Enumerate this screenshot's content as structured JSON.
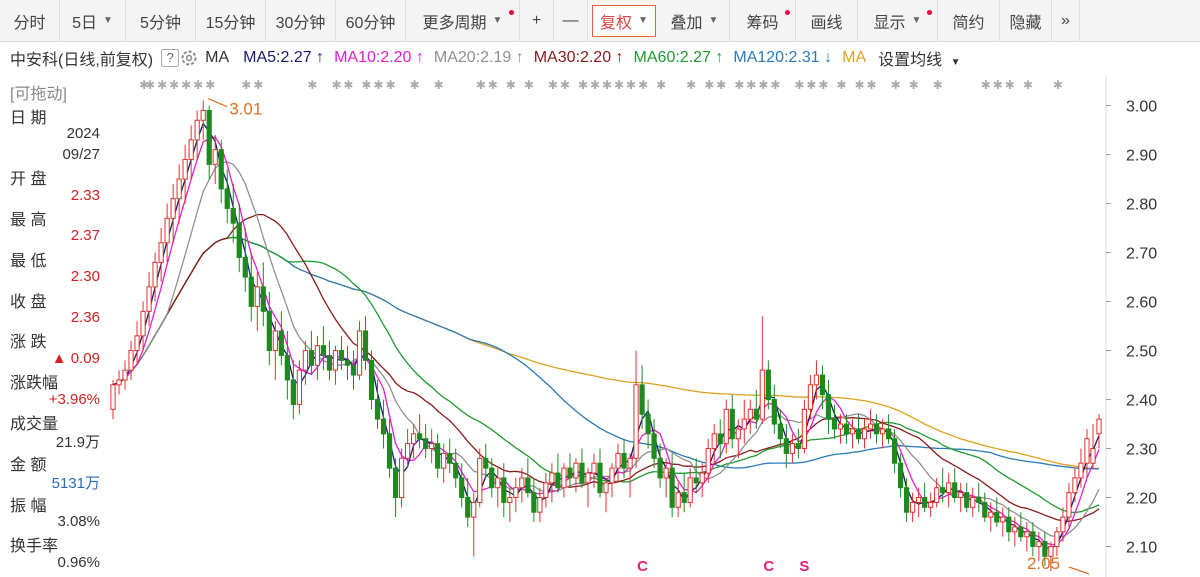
{
  "toolbar": {
    "items": [
      {
        "label": "分时",
        "caret": false,
        "dot": false,
        "active": false,
        "w": 60
      },
      {
        "label": "5日",
        "caret": true,
        "dot": false,
        "active": false,
        "w": 66
      },
      {
        "label": "5分钟",
        "caret": false,
        "dot": false,
        "active": false,
        "w": 70
      },
      {
        "label": "15分钟",
        "caret": false,
        "dot": false,
        "active": false,
        "w": 70
      },
      {
        "label": "30分钟",
        "caret": false,
        "dot": false,
        "active": false,
        "w": 70
      },
      {
        "label": "60分钟",
        "caret": false,
        "dot": false,
        "active": false,
        "w": 70
      },
      {
        "label": "更多周期",
        "caret": true,
        "dot": true,
        "active": false,
        "w": 114
      },
      {
        "label": "+",
        "caret": false,
        "dot": false,
        "active": false,
        "w": 34
      },
      {
        "label": "—",
        "caret": false,
        "dot": false,
        "active": false,
        "w": 34
      },
      {
        "label": "复权",
        "caret": true,
        "dot": false,
        "active": true,
        "w": 72
      },
      {
        "label": "叠加",
        "caret": true,
        "dot": false,
        "active": false,
        "w": 70
      },
      {
        "label": "筹码",
        "caret": false,
        "dot": true,
        "active": false,
        "w": 66
      },
      {
        "label": "画线",
        "caret": false,
        "dot": false,
        "active": false,
        "w": 62
      },
      {
        "label": "显示",
        "caret": true,
        "dot": true,
        "active": false,
        "w": 80
      },
      {
        "label": "简约",
        "caret": false,
        "dot": false,
        "active": false,
        "w": 62
      },
      {
        "label": "隐藏",
        "caret": false,
        "dot": false,
        "active": false,
        "w": 52
      },
      {
        "label": "»",
        "caret": false,
        "dot": false,
        "active": false,
        "w": 28
      }
    ],
    "caret_glyph": "▼"
  },
  "legend": {
    "stock": "中安科",
    "mode": "(日线,前复权)",
    "help": "?",
    "ma_label": "MA",
    "mas": [
      {
        "text": "MA5:2.27",
        "arrow": "↑",
        "color": "#1a1a6e"
      },
      {
        "text": "MA10:2.20",
        "arrow": "↑",
        "color": "#e020d0"
      },
      {
        "text": "MA20:2.19",
        "arrow": "↑",
        "color": "#909090"
      },
      {
        "text": "MA30:2.20",
        "arrow": "↑",
        "color": "#8b1a1a"
      },
      {
        "text": "MA60:2.27",
        "arrow": "↑",
        "color": "#1f9a2f"
      },
      {
        "text": "MA120:2.31",
        "arrow": "↓",
        "color": "#2a7ab8"
      },
      {
        "text": "MA",
        "arrow": "",
        "color": "#e0a020"
      }
    ],
    "settings": "设置均线"
  },
  "sidebar": {
    "title": "[可拖动]",
    "rows": [
      {
        "label": "日  期",
        "value": "",
        "color": "#333"
      },
      {
        "label": "",
        "value": "2024",
        "color": "#333"
      },
      {
        "label": "",
        "value": "09/27",
        "color": "#333"
      },
      {
        "label": "开  盘",
        "value": "",
        "color": "#333"
      },
      {
        "label": "",
        "value": "2.33",
        "color": "#d42020"
      },
      {
        "label": "最  高",
        "value": "",
        "color": "#333"
      },
      {
        "label": "",
        "value": "2.37",
        "color": "#d42020"
      },
      {
        "label": "最  低",
        "value": "",
        "color": "#333"
      },
      {
        "label": "",
        "value": "2.30",
        "color": "#d42020"
      },
      {
        "label": "收  盘",
        "value": "",
        "color": "#333"
      },
      {
        "label": "",
        "value": "2.36",
        "color": "#d42020"
      },
      {
        "label": "涨  跌",
        "value": "",
        "color": "#333"
      },
      {
        "label": "",
        "value": "▲ 0.09",
        "color": "#d42020"
      },
      {
        "label": "涨跌幅",
        "value": "",
        "color": "#333"
      },
      {
        "label": "",
        "value": "+3.96%",
        "color": "#d42020"
      },
      {
        "label": "成交量",
        "value": "",
        "color": "#333"
      },
      {
        "label": "",
        "value": "21.9万",
        "color": "#333"
      },
      {
        "label": "金  额",
        "value": "",
        "color": "#333"
      },
      {
        "label": "",
        "value": "5131万",
        "color": "#2a6ab8"
      },
      {
        "label": "振  幅",
        "value": "",
        "color": "#333"
      },
      {
        "label": "",
        "value": "3.08%",
        "color": "#333"
      },
      {
        "label": "换手率",
        "value": "",
        "color": "#333"
      },
      {
        "label": "",
        "value": "0.96%",
        "color": "#333"
      }
    ]
  },
  "chart_data": {
    "type": "candlestick",
    "ylim": [
      2.05,
      3.04
    ],
    "yticks": [
      3.0,
      2.9,
      2.8,
      2.7,
      2.6,
      2.5,
      2.4,
      2.3,
      2.2,
      2.1
    ],
    "up_color": "#e03030",
    "down_color": "#1e8a1e",
    "grid": false,
    "annotations": [
      {
        "text": "3.01",
        "index": 15,
        "price": 3.01
      },
      {
        "text": "2.05",
        "index": 163,
        "price": 2.05
      }
    ],
    "markers": [
      {
        "text": "C",
        "index": 88
      },
      {
        "text": "C",
        "index": 109
      },
      {
        "text": "S",
        "index": 115
      }
    ],
    "ohlc": [
      [
        2.38,
        2.44,
        2.36,
        2.43
      ],
      [
        2.43,
        2.46,
        2.41,
        2.44
      ],
      [
        2.44,
        2.48,
        2.42,
        2.46
      ],
      [
        2.46,
        2.52,
        2.44,
        2.5
      ],
      [
        2.5,
        2.56,
        2.47,
        2.53
      ],
      [
        2.53,
        2.6,
        2.5,
        2.58
      ],
      [
        2.58,
        2.66,
        2.55,
        2.63
      ],
      [
        2.63,
        2.7,
        2.6,
        2.68
      ],
      [
        2.68,
        2.75,
        2.64,
        2.72
      ],
      [
        2.72,
        2.8,
        2.68,
        2.77
      ],
      [
        2.77,
        2.84,
        2.72,
        2.81
      ],
      [
        2.81,
        2.88,
        2.76,
        2.85
      ],
      [
        2.85,
        2.92,
        2.8,
        2.89
      ],
      [
        2.89,
        2.96,
        2.85,
        2.93
      ],
      [
        2.93,
        2.99,
        2.89,
        2.97
      ],
      [
        2.97,
        3.01,
        2.93,
        2.99
      ],
      [
        2.99,
        3.0,
        2.85,
        2.88
      ],
      [
        2.88,
        2.94,
        2.84,
        2.91
      ],
      [
        2.91,
        2.93,
        2.8,
        2.83
      ],
      [
        2.83,
        2.87,
        2.76,
        2.79
      ],
      [
        2.79,
        2.84,
        2.72,
        2.76
      ],
      [
        2.76,
        2.8,
        2.66,
        2.69
      ],
      [
        2.69,
        2.75,
        2.62,
        2.65
      ],
      [
        2.65,
        2.7,
        2.56,
        2.59
      ],
      [
        2.59,
        2.66,
        2.54,
        2.63
      ],
      [
        2.63,
        2.68,
        2.55,
        2.58
      ],
      [
        2.58,
        2.62,
        2.47,
        2.5
      ],
      [
        2.5,
        2.56,
        2.44,
        2.54
      ],
      [
        2.54,
        2.58,
        2.47,
        2.49
      ],
      [
        2.49,
        2.54,
        2.4,
        2.44
      ],
      [
        2.44,
        2.48,
        2.36,
        2.39
      ],
      [
        2.39,
        2.48,
        2.37,
        2.46
      ],
      [
        2.46,
        2.52,
        2.43,
        2.5
      ],
      [
        2.5,
        2.54,
        2.45,
        2.47
      ],
      [
        2.47,
        2.53,
        2.44,
        2.51
      ],
      [
        2.51,
        2.55,
        2.46,
        2.49
      ],
      [
        2.49,
        2.52,
        2.44,
        2.46
      ],
      [
        2.46,
        2.51,
        2.43,
        2.5
      ],
      [
        2.5,
        2.53,
        2.46,
        2.48
      ],
      [
        2.48,
        2.51,
        2.44,
        2.47
      ],
      [
        2.47,
        2.5,
        2.42,
        2.45
      ],
      [
        2.45,
        2.56,
        2.44,
        2.54
      ],
      [
        2.54,
        2.57,
        2.46,
        2.48
      ],
      [
        2.48,
        2.5,
        2.38,
        2.4
      ],
      [
        2.4,
        2.44,
        2.34,
        2.36
      ],
      [
        2.36,
        2.4,
        2.3,
        2.33
      ],
      [
        2.33,
        2.36,
        2.24,
        2.26
      ],
      [
        2.26,
        2.28,
        2.16,
        2.2
      ],
      [
        2.2,
        2.3,
        2.18,
        2.28
      ],
      [
        2.28,
        2.34,
        2.26,
        2.31
      ],
      [
        2.31,
        2.35,
        2.28,
        2.33
      ],
      [
        2.33,
        2.37,
        2.3,
        2.32
      ],
      [
        2.32,
        2.35,
        2.28,
        2.3
      ],
      [
        2.3,
        2.34,
        2.27,
        2.31
      ],
      [
        2.31,
        2.33,
        2.24,
        2.26
      ],
      [
        2.26,
        2.31,
        2.23,
        2.29
      ],
      [
        2.29,
        2.32,
        2.25,
        2.27
      ],
      [
        2.27,
        2.3,
        2.22,
        2.24
      ],
      [
        2.24,
        2.27,
        2.18,
        2.2
      ],
      [
        2.2,
        2.24,
        2.14,
        2.16
      ],
      [
        2.16,
        2.21,
        2.08,
        2.19
      ],
      [
        2.19,
        2.3,
        2.18,
        2.28
      ],
      [
        2.28,
        2.31,
        2.24,
        2.26
      ],
      [
        2.26,
        2.28,
        2.2,
        2.22
      ],
      [
        2.22,
        2.26,
        2.18,
        2.24
      ],
      [
        2.24,
        2.27,
        2.16,
        2.19
      ],
      [
        2.19,
        2.22,
        2.15,
        2.2
      ],
      [
        2.2,
        2.24,
        2.17,
        2.22
      ],
      [
        2.22,
        2.26,
        2.19,
        2.24
      ],
      [
        2.24,
        2.28,
        2.2,
        2.21
      ],
      [
        2.21,
        2.24,
        2.15,
        2.17
      ],
      [
        2.17,
        2.22,
        2.15,
        2.2
      ],
      [
        2.2,
        2.25,
        2.18,
        2.23
      ],
      [
        2.23,
        2.27,
        2.19,
        2.25
      ],
      [
        2.25,
        2.29,
        2.21,
        2.22
      ],
      [
        2.22,
        2.27,
        2.2,
        2.26
      ],
      [
        2.26,
        2.29,
        2.22,
        2.24
      ],
      [
        2.24,
        2.28,
        2.21,
        2.27
      ],
      [
        2.27,
        2.3,
        2.22,
        2.23
      ],
      [
        2.23,
        2.26,
        2.18,
        2.25
      ],
      [
        2.25,
        2.29,
        2.22,
        2.27
      ],
      [
        2.27,
        2.3,
        2.2,
        2.21
      ],
      [
        2.21,
        2.24,
        2.17,
        2.23
      ],
      [
        2.23,
        2.27,
        2.2,
        2.26
      ],
      [
        2.26,
        2.31,
        2.23,
        2.29
      ],
      [
        2.29,
        2.32,
        2.24,
        2.26
      ],
      [
        2.26,
        2.29,
        2.2,
        2.28
      ],
      [
        2.28,
        2.5,
        2.26,
        2.43
      ],
      [
        2.43,
        2.47,
        2.34,
        2.37
      ],
      [
        2.37,
        2.4,
        2.3,
        2.33
      ],
      [
        2.33,
        2.36,
        2.26,
        2.28
      ],
      [
        2.28,
        2.31,
        2.22,
        2.24
      ],
      [
        2.24,
        2.28,
        2.2,
        2.26
      ],
      [
        2.26,
        2.29,
        2.16,
        2.18
      ],
      [
        2.18,
        2.23,
        2.16,
        2.21
      ],
      [
        2.21,
        2.25,
        2.17,
        2.19
      ],
      [
        2.19,
        2.26,
        2.18,
        2.24
      ],
      [
        2.24,
        2.28,
        2.21,
        2.23
      ],
      [
        2.23,
        2.27,
        2.2,
        2.25
      ],
      [
        2.25,
        2.32,
        2.23,
        2.3
      ],
      [
        2.3,
        2.35,
        2.27,
        2.33
      ],
      [
        2.33,
        2.36,
        2.28,
        2.31
      ],
      [
        2.31,
        2.4,
        2.29,
        2.38
      ],
      [
        2.38,
        2.41,
        2.3,
        2.32
      ],
      [
        2.32,
        2.36,
        2.28,
        2.34
      ],
      [
        2.34,
        2.4,
        2.31,
        2.36
      ],
      [
        2.36,
        2.4,
        2.33,
        2.38
      ],
      [
        2.38,
        2.42,
        2.34,
        2.36
      ],
      [
        2.36,
        2.57,
        2.35,
        2.46
      ],
      [
        2.46,
        2.48,
        2.38,
        2.4
      ],
      [
        2.4,
        2.43,
        2.33,
        2.35
      ],
      [
        2.35,
        2.38,
        2.3,
        2.32
      ],
      [
        2.32,
        2.35,
        2.26,
        2.29
      ],
      [
        2.29,
        2.33,
        2.27,
        2.31
      ],
      [
        2.31,
        2.34,
        2.28,
        2.3
      ],
      [
        2.3,
        2.4,
        2.29,
        2.38
      ],
      [
        2.38,
        2.45,
        2.36,
        2.43
      ],
      [
        2.43,
        2.48,
        2.4,
        2.45
      ],
      [
        2.45,
        2.47,
        2.38,
        2.41
      ],
      [
        2.41,
        2.44,
        2.33,
        2.36
      ],
      [
        2.36,
        2.39,
        2.32,
        2.34
      ],
      [
        2.34,
        2.37,
        2.31,
        2.35
      ],
      [
        2.35,
        2.37,
        2.31,
        2.33
      ],
      [
        2.33,
        2.36,
        2.3,
        2.34
      ],
      [
        2.34,
        2.37,
        2.31,
        2.32
      ],
      [
        2.32,
        2.36,
        2.3,
        2.34
      ],
      [
        2.34,
        2.38,
        2.32,
        2.35
      ],
      [
        2.35,
        2.37,
        2.31,
        2.33
      ],
      [
        2.33,
        2.36,
        2.3,
        2.34
      ],
      [
        2.34,
        2.37,
        2.31,
        2.32
      ],
      [
        2.32,
        2.34,
        2.25,
        2.27
      ],
      [
        2.27,
        2.29,
        2.2,
        2.22
      ],
      [
        2.22,
        2.24,
        2.15,
        2.17
      ],
      [
        2.17,
        2.21,
        2.15,
        2.19
      ],
      [
        2.19,
        2.22,
        2.16,
        2.2
      ],
      [
        2.2,
        2.23,
        2.17,
        2.18
      ],
      [
        2.18,
        2.21,
        2.16,
        2.19
      ],
      [
        2.19,
        2.24,
        2.18,
        2.22
      ],
      [
        2.22,
        2.26,
        2.19,
        2.21
      ],
      [
        2.21,
        2.25,
        2.18,
        2.23
      ],
      [
        2.23,
        2.26,
        2.19,
        2.2
      ],
      [
        2.2,
        2.23,
        2.17,
        2.21
      ],
      [
        2.21,
        2.23,
        2.17,
        2.18
      ],
      [
        2.18,
        2.22,
        2.16,
        2.2
      ],
      [
        2.2,
        2.23,
        2.17,
        2.19
      ],
      [
        2.19,
        2.21,
        2.15,
        2.16
      ],
      [
        2.16,
        2.19,
        2.13,
        2.17
      ],
      [
        2.17,
        2.2,
        2.14,
        2.15
      ],
      [
        2.15,
        2.18,
        2.12,
        2.16
      ],
      [
        2.16,
        2.18,
        2.11,
        2.13
      ],
      [
        2.13,
        2.16,
        2.1,
        2.14
      ],
      [
        2.14,
        2.17,
        2.11,
        2.12
      ],
      [
        2.12,
        2.15,
        2.09,
        2.13
      ],
      [
        2.13,
        2.15,
        2.08,
        2.1
      ],
      [
        2.1,
        2.13,
        2.07,
        2.11
      ],
      [
        2.11,
        2.13,
        2.06,
        2.08
      ],
      [
        2.08,
        2.11,
        2.05,
        2.1
      ],
      [
        2.1,
        2.14,
        2.08,
        2.13
      ],
      [
        2.13,
        2.18,
        2.11,
        2.16
      ],
      [
        2.16,
        2.23,
        2.14,
        2.21
      ],
      [
        2.21,
        2.26,
        2.19,
        2.24
      ],
      [
        2.24,
        2.3,
        2.22,
        2.27
      ],
      [
        2.27,
        2.34,
        2.24,
        2.32
      ],
      [
        2.27,
        2.35,
        2.26,
        2.3
      ],
      [
        2.33,
        2.37,
        2.3,
        2.36
      ]
    ]
  }
}
